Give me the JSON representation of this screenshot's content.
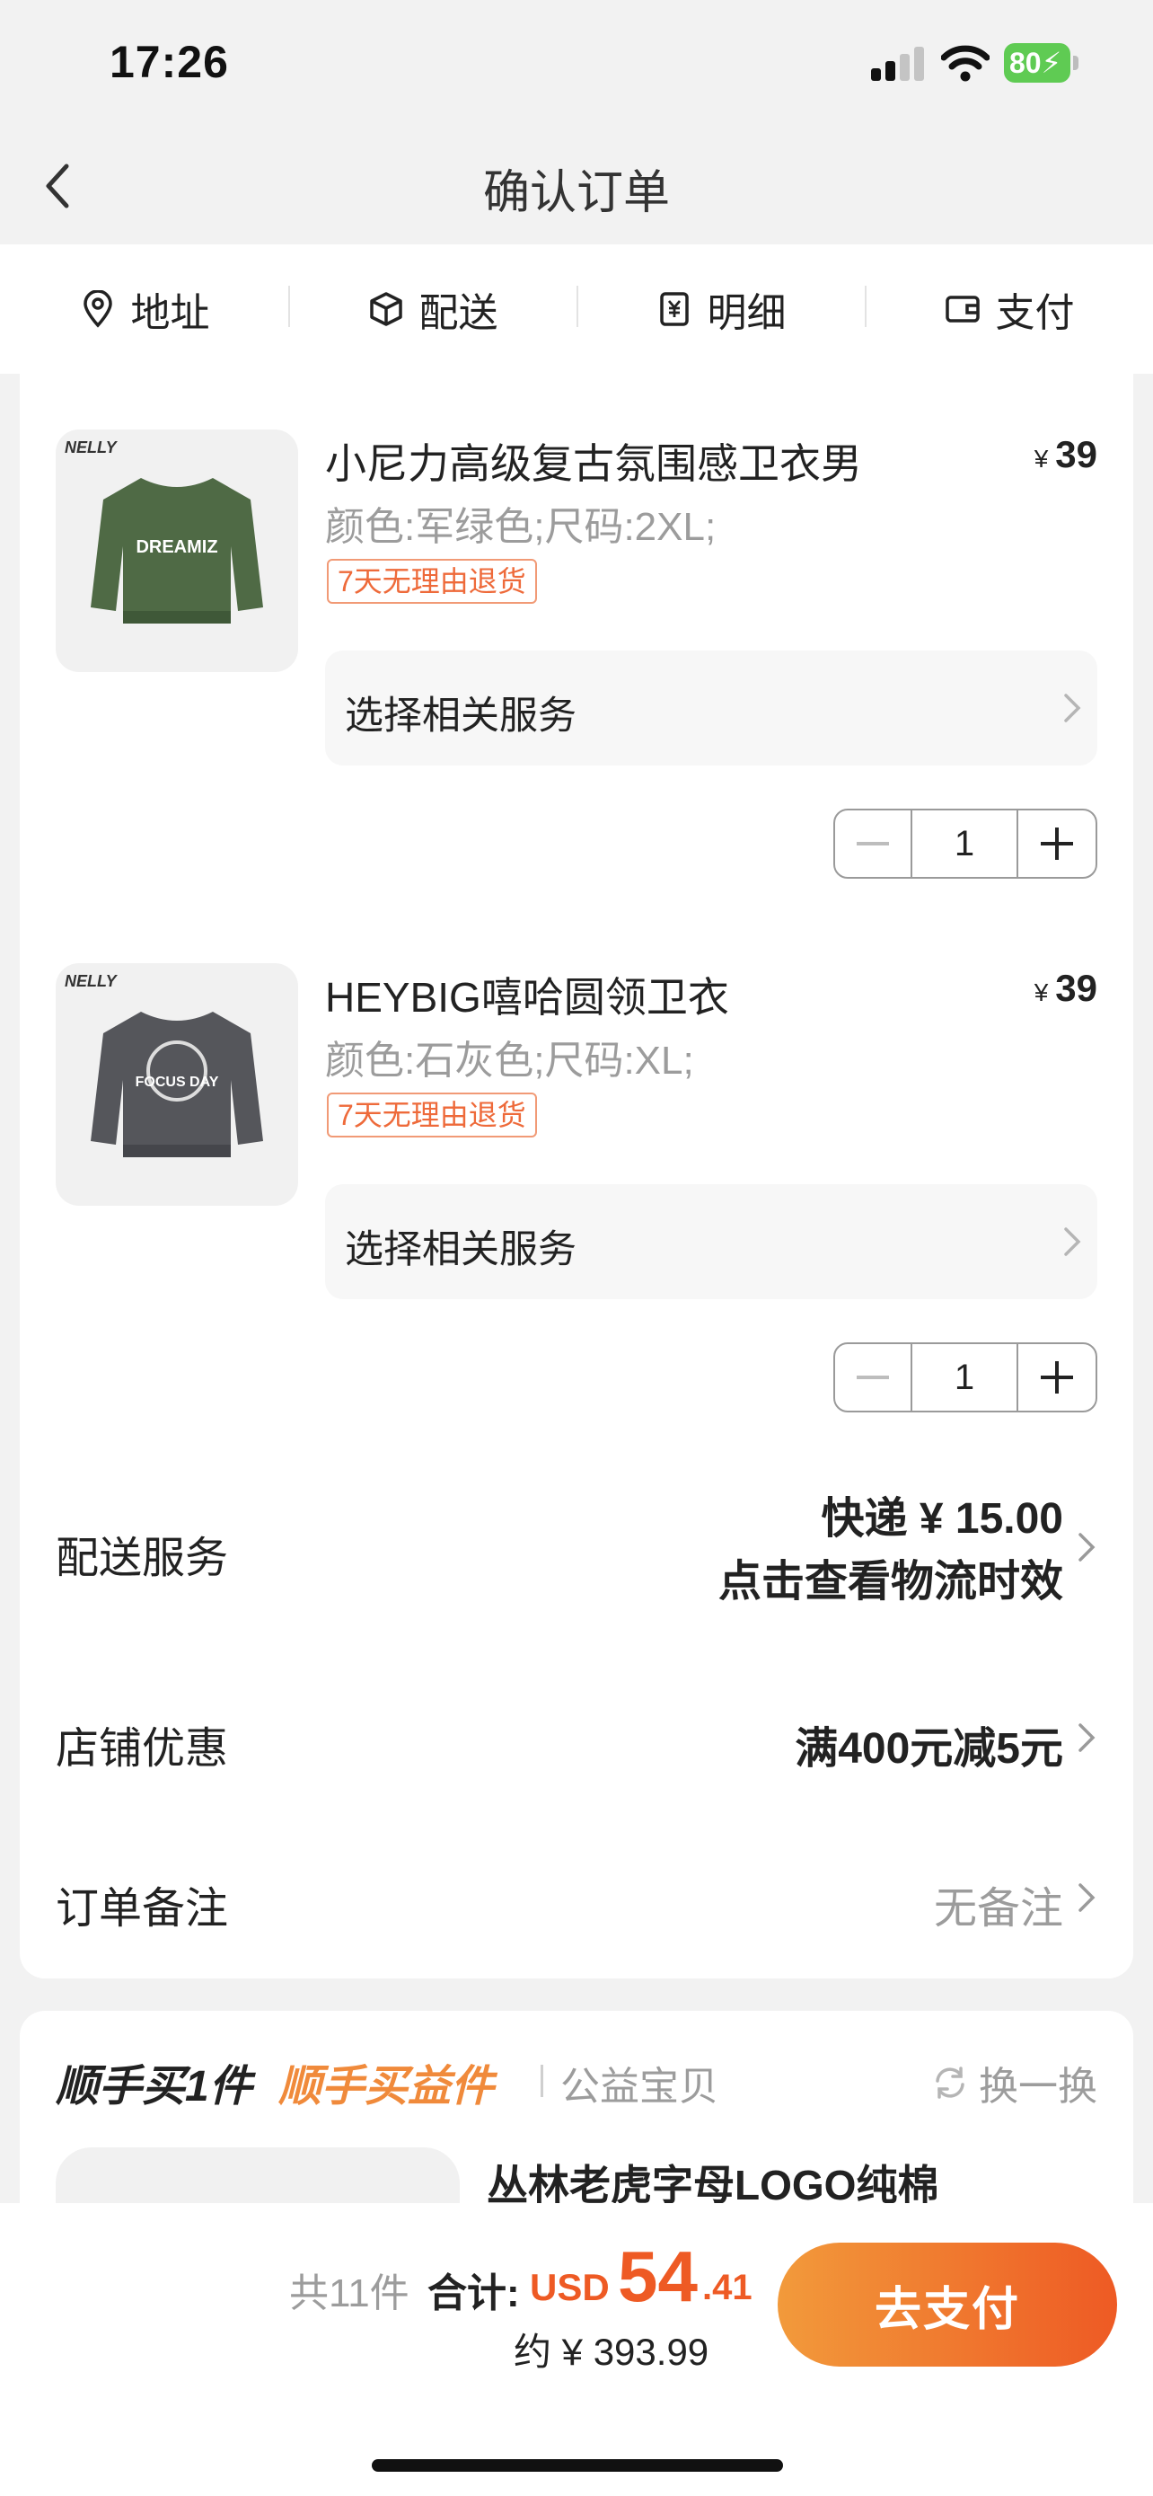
{
  "status_bar": {
    "time": "17:26",
    "battery": "80"
  },
  "header": {
    "title": "确认订单"
  },
  "steps": [
    {
      "label": "地址",
      "icon": "location-pin-icon"
    },
    {
      "label": "配送",
      "icon": "package-box-icon"
    },
    {
      "label": "明细",
      "icon": "yuan-receipt-icon"
    },
    {
      "label": "支付",
      "icon": "wallet-icon"
    }
  ],
  "items": [
    {
      "title": "小尼力高级复古氛围感卫衣男",
      "price_symbol": "¥",
      "price": "39",
      "spec": "颜色:军绿色;尺码:2XL;",
      "return_tag": "7天无理由退货",
      "service_label": "选择相关服务",
      "qty": "1",
      "thumb_brand": "NELLY",
      "thumb_print": "DREAMIZ",
      "thumb_color": "#4f6a45"
    },
    {
      "title": "HEYBIG嘻哈圆领卫衣",
      "price_symbol": "¥",
      "price": "39",
      "spec": "颜色:石灰色;尺码:XL;",
      "return_tag": "7天无理由退货",
      "service_label": "选择相关服务",
      "qty": "1",
      "thumb_brand": "NELLY",
      "thumb_print": "FOCUS DAY",
      "thumb_color": "#55565b"
    }
  ],
  "delivery": {
    "label": "配送服务",
    "value_line1": "快递 ¥ 15.00",
    "value_line2": "点击查看物流时效"
  },
  "store_discount": {
    "label": "店铺优惠",
    "value": "满400元减5元"
  },
  "order_note": {
    "label": "订单备注",
    "value": "无备注"
  },
  "bundle": {
    "title_main": "顺手买1件",
    "title_accent": "顺手买益件",
    "subtitle": "公益宝贝",
    "refresh_label": "换一换",
    "product_title": "丛林老虎字母LOGO纯棉"
  },
  "footer": {
    "count_text": "共11件",
    "total_label": "合计:",
    "currency": "USD",
    "total_int": "54",
    "total_dec": ".41",
    "approx": "约 ¥ 393.99",
    "pay_button": "去支付"
  },
  "colors": {
    "accent": "#ee5a24",
    "accent_light": "#f29a3b",
    "tag_border": "#f19a76"
  }
}
